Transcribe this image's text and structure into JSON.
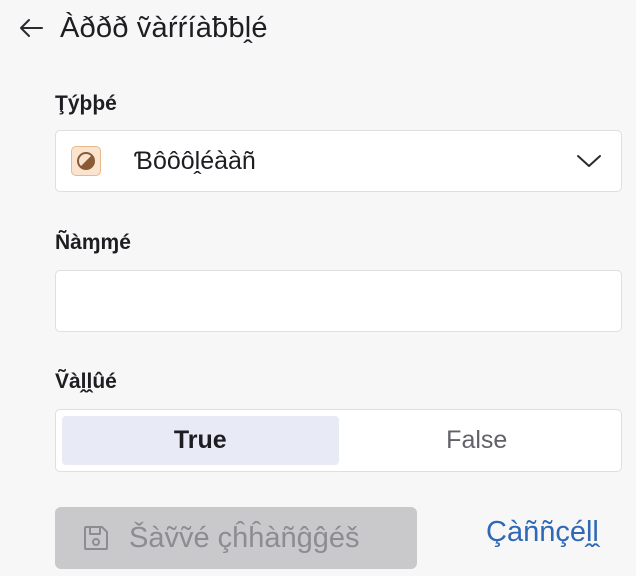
{
  "header": {
    "back_icon": "arrow-left-icon",
    "title": "Àððð ṽàŕŕíàƀƀḽé"
  },
  "type_field": {
    "label": "Ţýþþé",
    "value": "Ɓôôôḽéààñ",
    "icon": "boolean-type-icon",
    "icon_color": "#fbe4cf",
    "chevron_icon": "chevron-down-icon"
  },
  "name_field": {
    "label": "Ñàɱɱé",
    "value": "",
    "placeholder": ""
  },
  "value_field": {
    "label": "Ṽàḽḽûé",
    "options": [
      "True",
      "False"
    ],
    "selected": "True"
  },
  "actions": {
    "save_label": "Šàṽṽé çĥĥàñĝĝéš",
    "save_icon": "save-icon",
    "save_disabled": true,
    "cancel_label": "Çàññçéḽḽ",
    "link_color": "#2f68b4"
  }
}
